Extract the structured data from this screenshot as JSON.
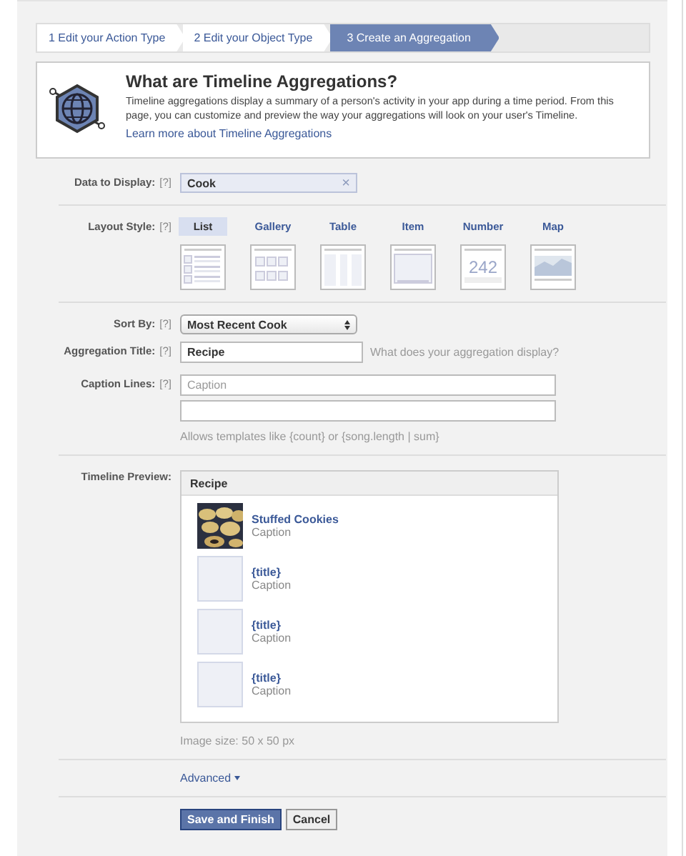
{
  "steps": [
    {
      "label": "1 Edit your Action Type",
      "selected": false
    },
    {
      "label": "2 Edit your Object Type",
      "selected": false
    },
    {
      "label": "3 Create an Aggregation",
      "selected": true
    }
  ],
  "info": {
    "title": "What are Timeline Aggregations?",
    "text": "Timeline aggregations display a summary of a person's activity in your app during a time period. From this page, you can customize and preview the way your aggregations will look on your user's Timeline.",
    "link": "Learn more about Timeline Aggregations"
  },
  "data_to_display": {
    "label": "Data to Display:",
    "help": "[?]",
    "token": "Cook",
    "remove": "×"
  },
  "layout_style": {
    "label": "Layout Style:",
    "help": "[?]",
    "options": [
      {
        "label": "List",
        "kind": "list",
        "selected": true
      },
      {
        "label": "Gallery",
        "kind": "gallery",
        "selected": false
      },
      {
        "label": "Table",
        "kind": "table",
        "selected": false
      },
      {
        "label": "Item",
        "kind": "item",
        "selected": false
      },
      {
        "label": "Number",
        "kind": "number",
        "figure": "242",
        "selected": false
      },
      {
        "label": "Map",
        "kind": "map",
        "selected": false
      }
    ]
  },
  "sort_by": {
    "label": "Sort By:",
    "help": "[?]",
    "value": "Most Recent Cook"
  },
  "aggregation_title": {
    "label": "Aggregation Title:",
    "help": "[?]",
    "value": "Recipe",
    "hint": "What does your aggregation display?"
  },
  "caption_lines": {
    "label": "Caption Lines:",
    "help": "[?]",
    "placeholder": "Caption",
    "hint": "Allows templates like {count} or {song.length | sum}"
  },
  "timeline_preview": {
    "label": "Timeline Preview:",
    "header": "Recipe",
    "items": [
      {
        "kind": "picture",
        "title": "Stuffed Cookies",
        "caption": "Caption"
      },
      {
        "kind": "placeholder",
        "title": "{title}",
        "caption": "Caption"
      },
      {
        "kind": "placeholder",
        "title": "{title}",
        "caption": "Caption"
      },
      {
        "kind": "placeholder",
        "title": "{title}",
        "caption": "Caption"
      }
    ],
    "note": "Image size: 50 x 50 px"
  },
  "advanced": "Advanced",
  "buttons": [
    {
      "label": "Save and Finish",
      "kind": "primary"
    },
    {
      "label": "Cancel",
      "kind": "secondary"
    }
  ]
}
